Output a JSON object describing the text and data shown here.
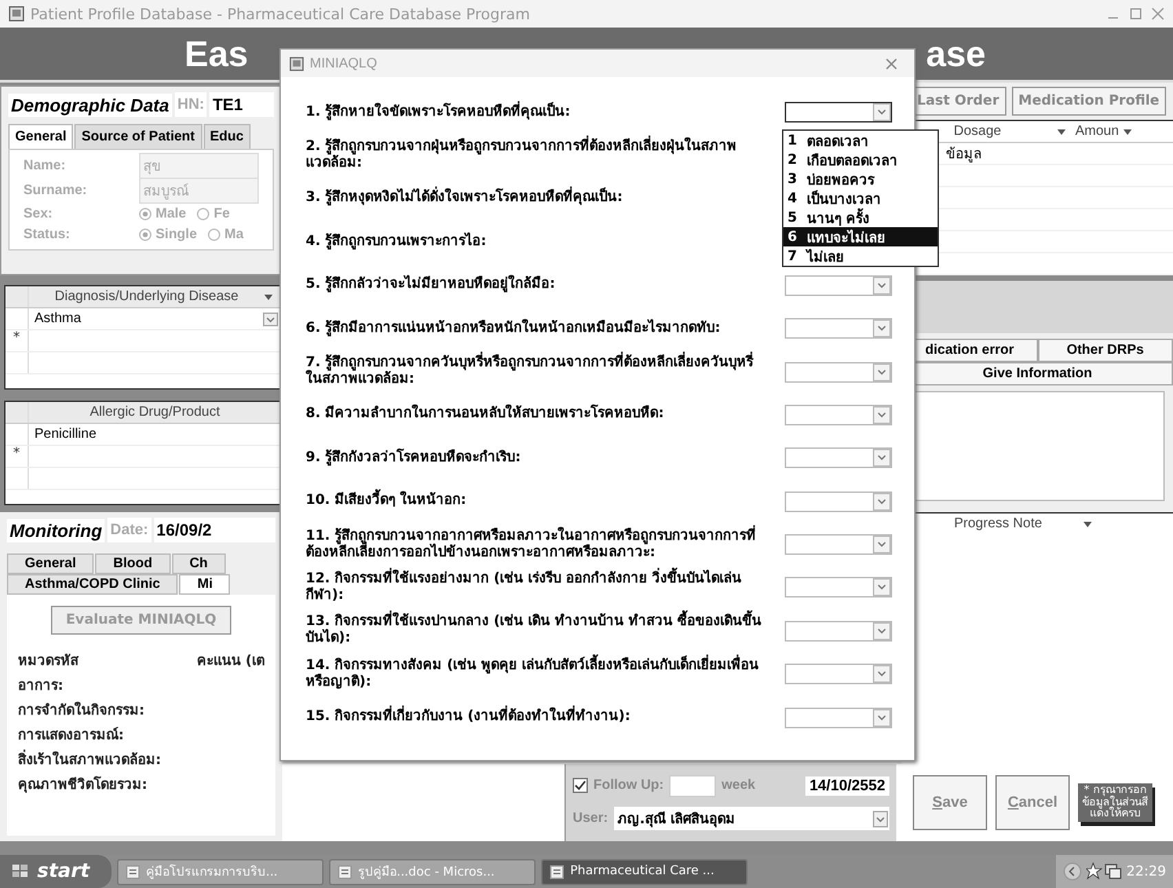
{
  "window": {
    "title": "Patient Profile Database - Pharmaceutical Care Database Program"
  },
  "header": {
    "left_text": "Eas",
    "right_text": "ase"
  },
  "demographic": {
    "title": "Demographic Data",
    "hn_label": "HN:",
    "hn_value": "TE1",
    "tabs": [
      {
        "label": "General",
        "selected": true
      },
      {
        "label": "Source of Patient",
        "selected": false
      },
      {
        "label": "Educ",
        "selected": false
      }
    ],
    "fields": [
      {
        "label": "Name:",
        "kind": "text",
        "value": "สุข"
      },
      {
        "label": "Surname:",
        "kind": "text",
        "value": "สมบูรณ์"
      },
      {
        "label": "Sex:",
        "kind": "radio",
        "options": [
          {
            "label": "Male",
            "selected": true
          },
          {
            "label": "Fe",
            "selected": false
          }
        ]
      },
      {
        "label": "Status:",
        "kind": "radio",
        "options": [
          {
            "label": "Single",
            "selected": true
          },
          {
            "label": "Ma",
            "selected": false
          }
        ]
      }
    ]
  },
  "diagnosis_table": {
    "column": "Diagnosis/Underlying Disease",
    "rows": [
      "Asthma"
    ],
    "new_row_marker": "*"
  },
  "allergy_table": {
    "column": "Allergic Drug/Product",
    "rows": [
      "Penicilline"
    ],
    "new_row_marker": "*"
  },
  "monitoring": {
    "title": "Monitoring",
    "date_label": "Date:",
    "date_value": "16/09/2",
    "tab_rows": [
      [
        {
          "label": "General",
          "selected": false
        },
        {
          "label": "Blood",
          "selected": false
        },
        {
          "label": "Ch",
          "selected": false
        }
      ],
      [
        {
          "label": "Asthma/COPD Clinic",
          "selected": false
        },
        {
          "label": "Mi",
          "selected": true
        }
      ]
    ],
    "evaluate_button": "Evaluate MINIAQLQ",
    "headers": [
      "หมวดรหัส",
      "คะแนน (เต"
    ],
    "categories": [
      "อาการ:",
      "การจำกัดในกิจกรรม:",
      "การแสดงอารมณ์:",
      "สิ่งเร้าในสภาพแวดล้อม:",
      "คุณภาพชีวิตโดยรวม:"
    ]
  },
  "top_buttons": [
    "Last Order",
    "Medication Profile"
  ],
  "medication_table": {
    "columns": [
      "Dosage",
      "Amoun"
    ],
    "rows": [
      "ข้อมูล"
    ]
  },
  "drp_tabs": [
    "dication error",
    "Other DRPs"
  ],
  "give_information": "Give Information",
  "progress_table": {
    "column": "Progress Note"
  },
  "follow_up": {
    "checked": true,
    "label": "Follow Up:",
    "unit": "week",
    "date": "14/10/2552",
    "user_label": "User:",
    "user": "ภญ.สุณี เลิศสินอุดม"
  },
  "buttons": [
    "Save",
    "Cancel"
  ],
  "note": "* กรุณากรอกข้อมูลในส่วนสีแดงให้ครบ",
  "dialog": {
    "title": "MINIAQLQ",
    "questions": [
      {
        "text": "1. รู้สึกหายใจขัดเพราะโรคหอบหืดที่คุณเป็น:",
        "dropdown": {
          "expanded": true,
          "options": [
            {
              "number": "1",
              "label": "ตลอดเวลา",
              "selected": false
            },
            {
              "number": "2",
              "label": "เกือบตลอดเวลา",
              "selected": false
            },
            {
              "number": "3",
              "label": "บ่อยพอควร",
              "selected": false
            },
            {
              "number": "4",
              "label": "เป็นบางเวลา",
              "selected": false
            },
            {
              "number": "5",
              "label": "นานๆ ครั้ง",
              "selected": false
            },
            {
              "number": "6",
              "label": "แทบจะไม่เลย",
              "selected": true
            },
            {
              "number": "7",
              "label": "ไม่เลย",
              "selected": false
            }
          ]
        }
      },
      {
        "text": "2. รู้สึกถูกรบกวนจากฝุ่นหรือถูกรบกวนจากการที่ต้องหลีกเลี่ยงฝุ่นในสภาพแวดล้อม:"
      },
      {
        "text": "3. รู้สึกหงุดหงิดไม่ได้ดั่งใจเพราะโรคหอบหืดที่คุณเป็น:"
      },
      {
        "text": "4. รู้สึกถูกรบกวนเพราะการไอ:"
      },
      {
        "text": "5. รู้สึกกลัวว่าจะไม่มียาหอบหืดอยู่ใกล้มือ:"
      },
      {
        "text": "6. รู้สึกมีอาการแน่นหน้าอกหรือหนักในหน้าอกเหมือนมีอะไรมากดทับ:"
      },
      {
        "text": "7. รู้สึกถูกรบกวนจากควันบุหรี่หรือถูกรบกวนจากการที่ต้องหลีกเลี่ยงควันบุหรี่ในสภาพแวดล้อม:"
      },
      {
        "text": "8. มีความลำบากในการนอนหลับให้สบายเพราะโรคหอบหืด:"
      },
      {
        "text": "9. รู้สึกกังวลว่าโรคหอบหืดจะกำเริบ:"
      },
      {
        "text": "10. มีเสียงวี้ดๆ ในหน้าอก:"
      },
      {
        "text": "11. รู้สึกถูกรบกวนจากอากาศหรือมลภาวะในอากาศหรือถูกรบกวนจากการที่ต้องหลีกเลี่ยงการออกไปข้างนอกเพราะอากาศหรือมลภาวะ:"
      },
      {
        "text": "12. กิจกรรมที่ใช้แรงอย่างมาก (เช่น เร่งรีบ ออกกำลังกาย วิ่งขึ้นบันไดเล่นกีฬา):"
      },
      {
        "text": "13. กิจกรรมที่ใช้แรงปานกลาง (เช่น เดิน ทำงานบ้าน ทำสวน ซื้อของเดินขึ้นบันได):"
      },
      {
        "text": "14. กิจกรรมทางสังคม (เช่น พูดคุย เล่นกับสัตว์เลี้ยงหรือเล่นกับเด็กเยี่ยมเพื่อนหรือญาติ):"
      },
      {
        "text": "15. กิจกรรมที่เกี่ยวกับงาน (งานที่ต้องทำในที่ทำงาน):"
      }
    ]
  },
  "taskbar": {
    "start": "start",
    "items": [
      {
        "label": "คู่มือโปรแกรมการบริบ...",
        "selected": false
      },
      {
        "label": "รูปคู่มือ...doc - Micros...",
        "selected": false
      },
      {
        "label": "Pharmaceutical Care ...",
        "selected": true
      }
    ],
    "clock": "22:29"
  }
}
